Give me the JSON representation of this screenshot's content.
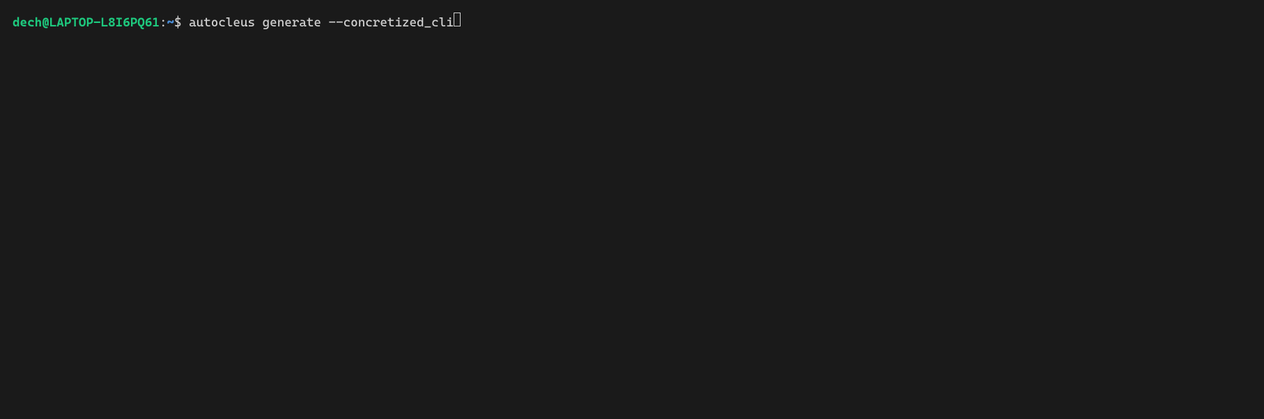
{
  "prompt": {
    "user_host": "dech@LAPTOP-L8I6PQ61",
    "colon": ":",
    "path": "~",
    "dollar": "$ ",
    "command": "autocleus generate --concretized_cli"
  },
  "colors": {
    "background": "#1a1a1a",
    "user_host": "#1ec97e",
    "path": "#4a8dd6",
    "text": "#d0d0d0"
  }
}
